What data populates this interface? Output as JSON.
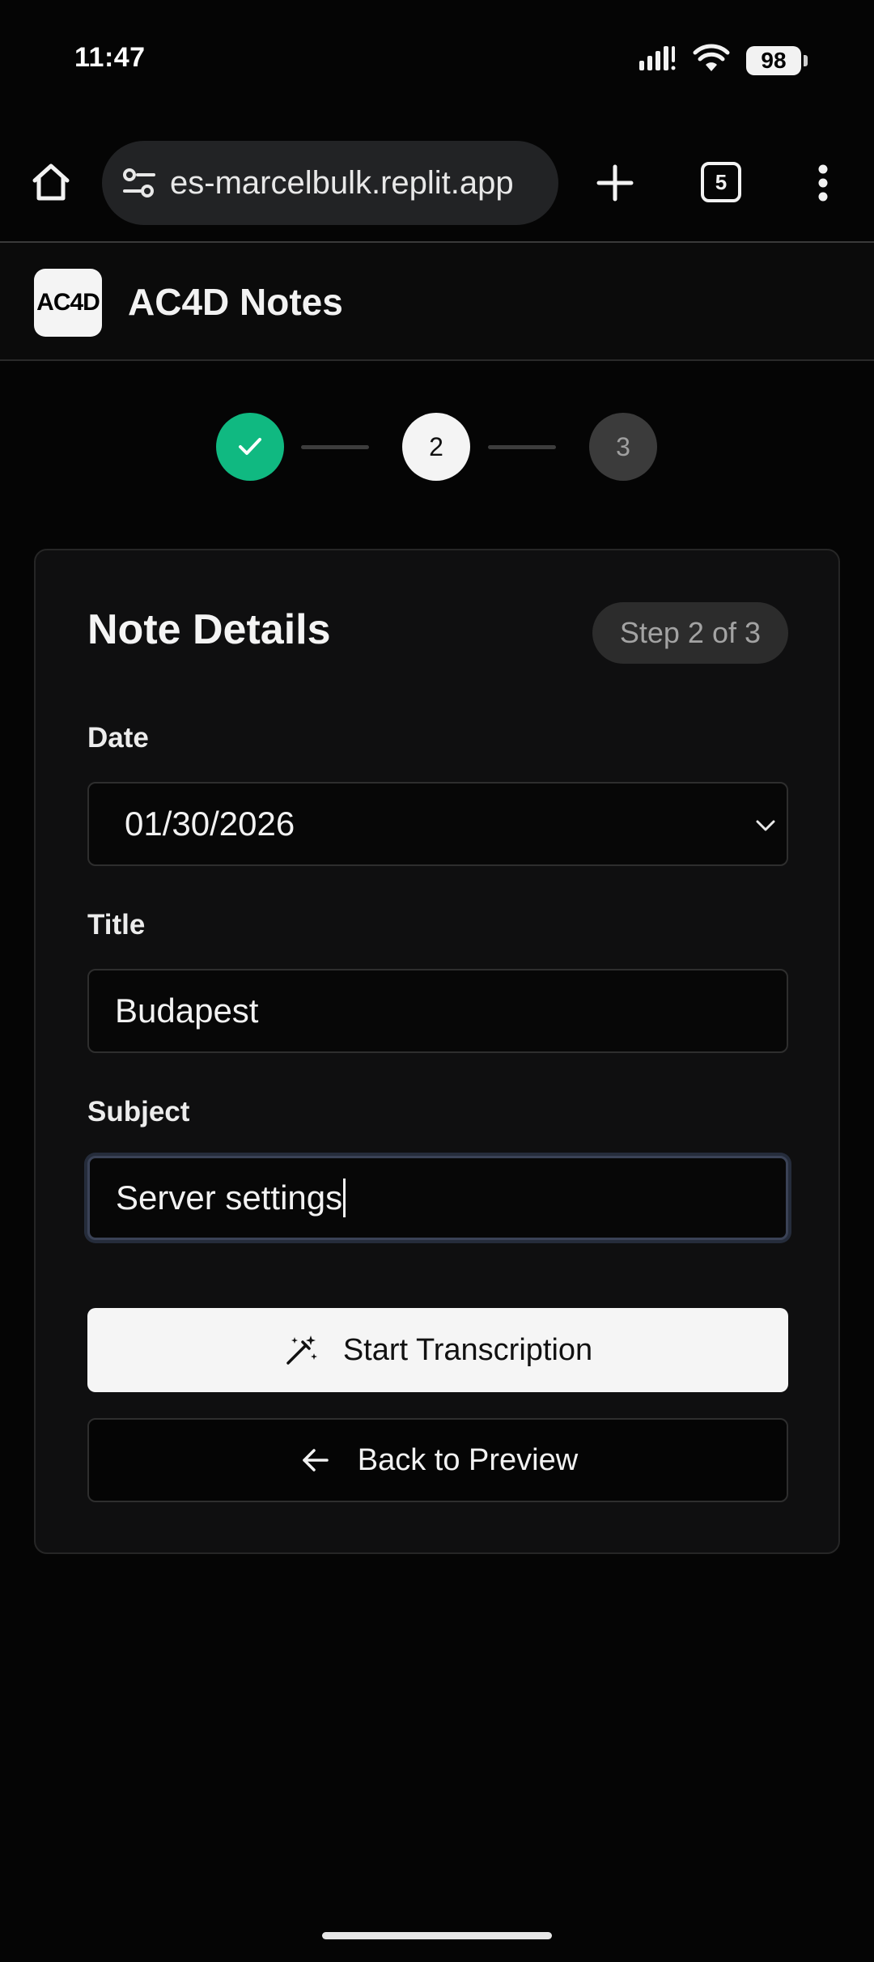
{
  "status_bar": {
    "time": "11:47",
    "battery": "98"
  },
  "browser": {
    "url": "es-marcelbulk.replit.app",
    "tab_count": "5"
  },
  "app": {
    "logo_text": "AC4D",
    "title": "AC4D Notes"
  },
  "stepper": {
    "steps": [
      {
        "label": "",
        "state": "complete"
      },
      {
        "label": "2",
        "state": "current"
      },
      {
        "label": "3",
        "state": "upcoming"
      }
    ],
    "colors": {
      "complete": "#10b981",
      "current": "#f4f4f4",
      "upcoming": "#3b3b3b"
    }
  },
  "card": {
    "title": "Note Details",
    "badge": "Step 2 of 3",
    "fields": {
      "date": {
        "label": "Date",
        "value": "01/30/2026"
      },
      "title": {
        "label": "Title",
        "value": "Budapest"
      },
      "subject": {
        "label": "Subject",
        "value": "Server settings"
      }
    },
    "primary_button": "Start Transcription",
    "secondary_button": "Back to Preview"
  }
}
